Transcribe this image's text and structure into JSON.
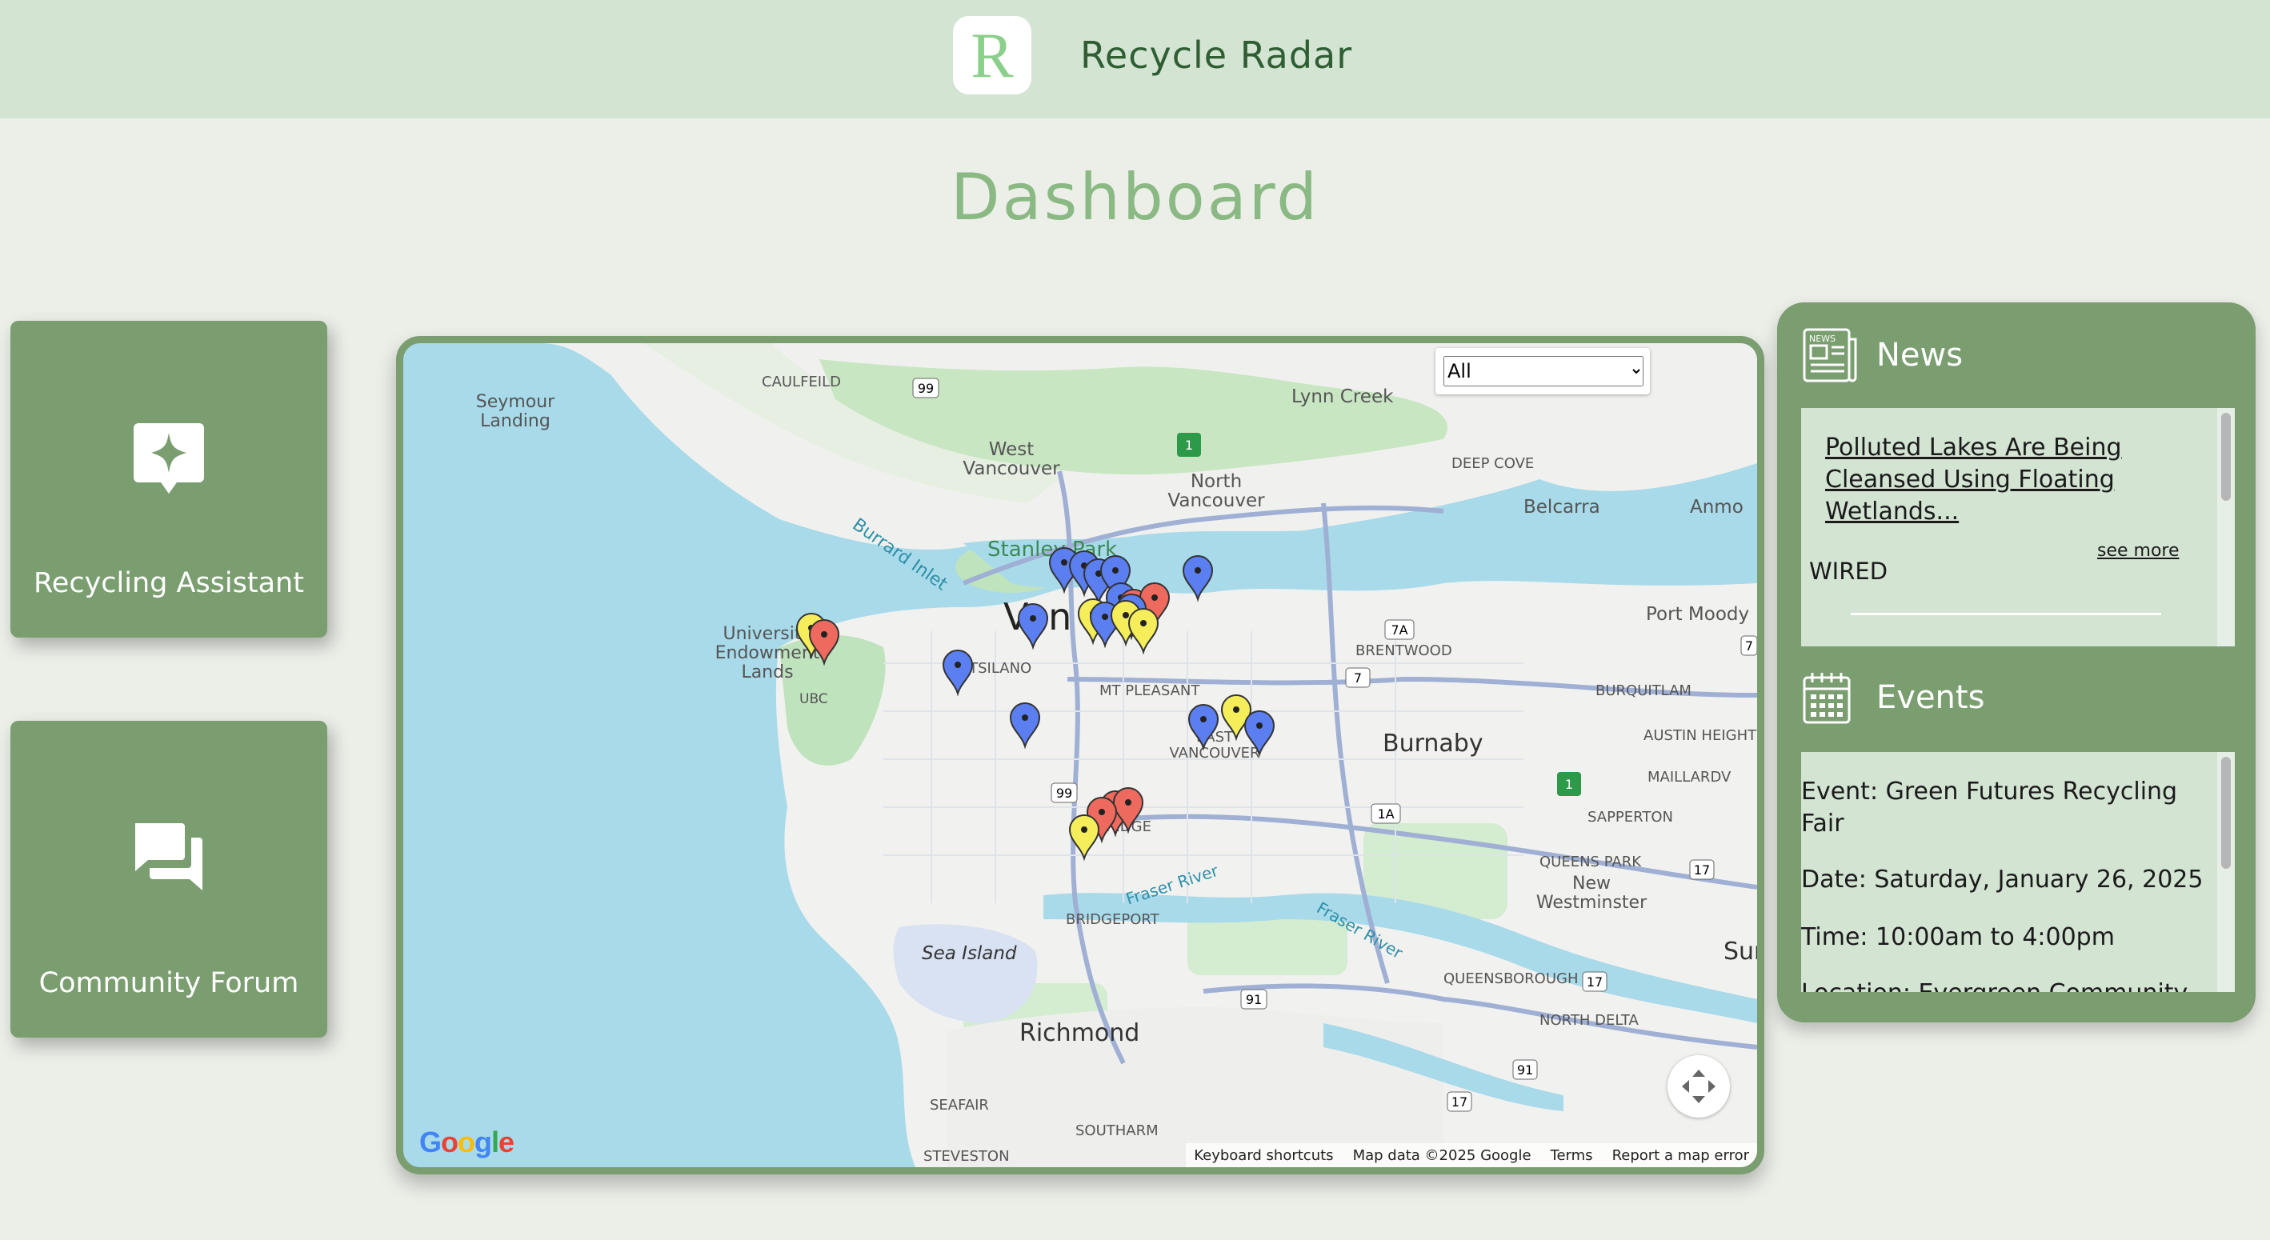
{
  "header": {
    "logo_letter": "R",
    "app_title": "Recycle Radar"
  },
  "page": {
    "title": "Dashboard"
  },
  "cards": [
    {
      "label": "Recycling Assistant",
      "icon": "sparkle-chat-icon"
    },
    {
      "label": "Community Forum",
      "icon": "forum-icon"
    }
  ],
  "map": {
    "filter": {
      "selected": "All",
      "options": [
        "All"
      ]
    },
    "place_labels": [
      "Seymour\nLanding",
      "CAULFEILD",
      "Lynn Creek",
      "West\nVancouver",
      "North\nVancouver",
      "DEEP COVE",
      "Belcarra",
      "Anmo",
      "Burrard Inlet",
      "Stanley Park",
      "Van",
      "University\nEndowment\nLands",
      "UBC",
      "KITSILANO",
      "MT PLEASANT",
      "BRENTWOOD",
      "Port Moody",
      "BURQUITLAM",
      "EAST\nVANCOUVER",
      "Burnaby",
      "AUSTIN HEIGHTS",
      "MAILLARDV",
      "OAKRIDGE",
      "SAPPERTON",
      "QUEENS PARK",
      "New\nWestminster",
      "Fraser River",
      "Fraser River",
      "BRIDGEPORT",
      "Sea Island",
      "Sur",
      "QUEENSBOROUGH",
      "NORTH DELTA",
      "Richmond",
      "SEAFAIR",
      "SOUTHARM",
      "STEVESTON"
    ],
    "road_shields": [
      "99",
      "1",
      "7A",
      "7",
      "99",
      "1A",
      "1",
      "17",
      "91",
      "17",
      "91",
      "17",
      "7"
    ],
    "footer": {
      "shortcuts": "Keyboard shortcuts",
      "map_data": "Map data ©2025 Google",
      "terms": "Terms",
      "report": "Report a map error"
    },
    "google_logo": "Google",
    "pin_colors": {
      "blue": "#5b7ff0",
      "yellow": "#f5ee5a",
      "red": "#ee6a5f"
    }
  },
  "news": {
    "heading": "News",
    "icon": "newspaper-icon",
    "icon_text": "NEWS",
    "items": [
      {
        "title": "Polluted Lakes Are Being Cleansed Using Floating Wetlands...",
        "see_more": "see more",
        "source": "WIRED"
      }
    ]
  },
  "events": {
    "heading": "Events",
    "icon": "calendar-icon",
    "items": [
      {
        "event": "Event: Green Futures Recycling Fair",
        "date": "Date: Saturday, January 26, 2025",
        "time": "Time: 10:00am to 4:00pm",
        "location": "Location: Evergreen Community"
      }
    ]
  }
}
